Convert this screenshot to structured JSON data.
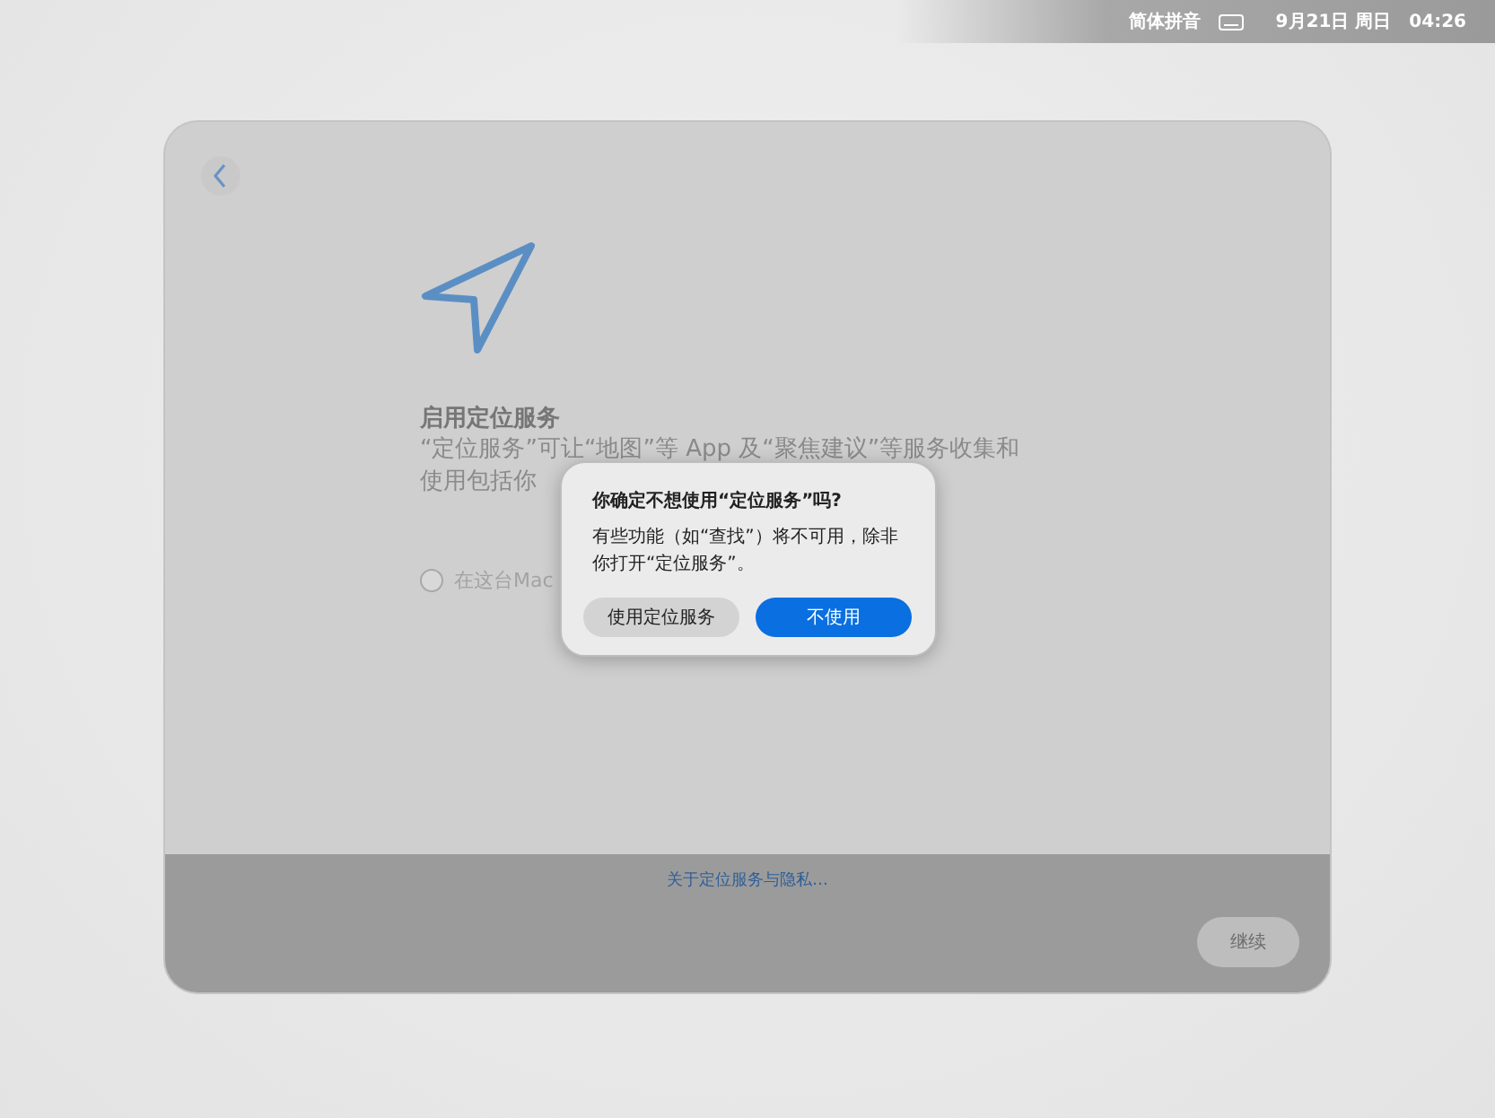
{
  "menu_bar": {
    "input_method": "简体拼音",
    "date": "9月21日 周日",
    "time": "04:26"
  },
  "page": {
    "title": "启用定位服务",
    "description_lines": [
      "“定位服务”可让“地图”等 App 及“聚焦建议”等服务收集和",
      "使用包括你"
    ],
    "checkbox": {
      "label": "在这台Mac",
      "checked": false
    },
    "footer_link": "关于定位服务与隐私…",
    "continue_button": {
      "label": "继续",
      "disabled": true
    }
  },
  "dialog": {
    "title": "你确定不想使用“定位服务”吗?",
    "message": "有些功能（如“查找”）将不可用，除非你打开“定位服务”。",
    "buttons": [
      {
        "label": "使用定位服务",
        "default": false
      },
      {
        "label": "不使用",
        "default": true
      }
    ]
  }
}
